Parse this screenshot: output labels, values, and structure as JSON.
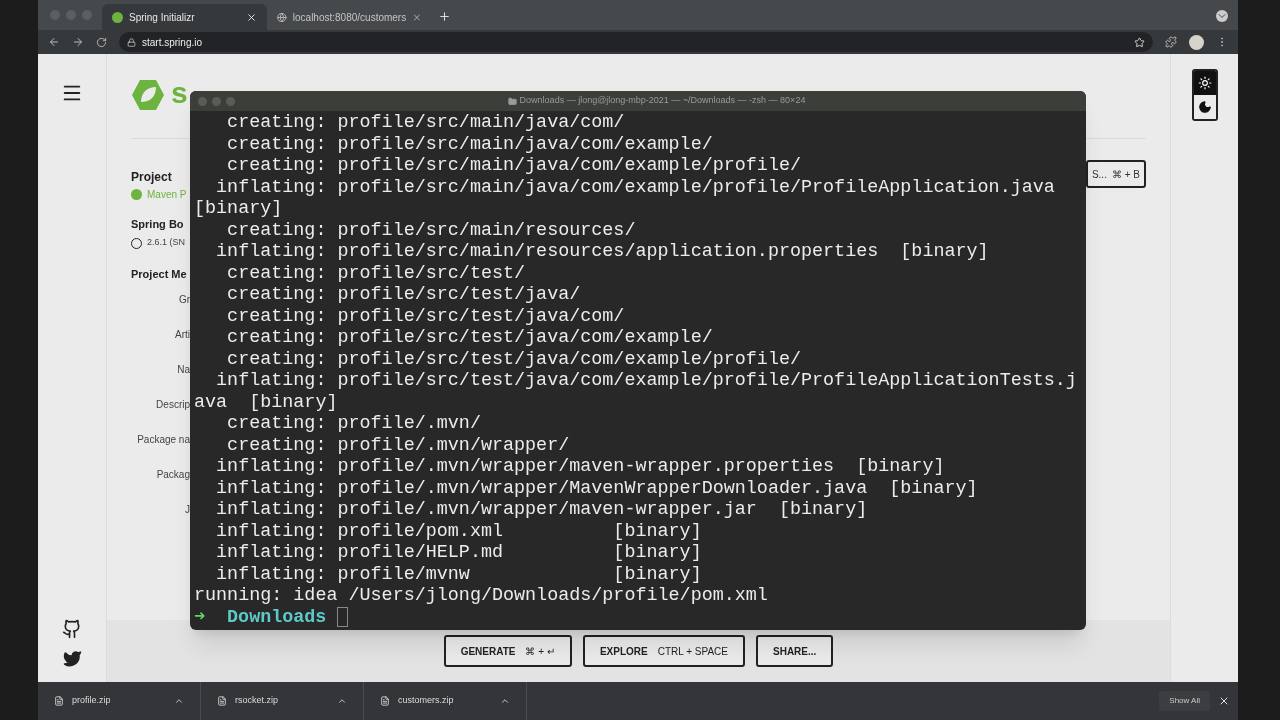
{
  "browser": {
    "tabs": [
      {
        "title": "Spring Initializr",
        "selected": true
      },
      {
        "title": "localhost:8080/customers",
        "selected": false
      }
    ],
    "address": "start.spring.io"
  },
  "page": {
    "logo_text": "s",
    "project": {
      "heading": "Project",
      "options": [
        {
          "label": "Maven P",
          "selected": true
        }
      ]
    },
    "spring_boot": {
      "heading": "Spring Bo",
      "options": [
        {
          "label": "2.6.1 (SN",
          "selected": false
        }
      ]
    },
    "metadata": {
      "heading": "Project Me",
      "labels": [
        "Gr",
        "Arti",
        "Na",
        "Descrip",
        "Package na",
        "Packag",
        "J"
      ]
    },
    "dependencies_button": {
      "label": "S...",
      "shortcut": "⌘ + B"
    },
    "theme_toggle": [
      {
        "kind": "light",
        "selected": true
      },
      {
        "kind": "dark",
        "selected": false
      }
    ],
    "actions": [
      {
        "label": "GENERATE",
        "shortcut": "⌘ + ↵"
      },
      {
        "label": "EXPLORE",
        "shortcut": "CTRL + SPACE"
      },
      {
        "label": "SHARE..."
      }
    ]
  },
  "terminal": {
    "title": "Downloads — jlong@jlong-mbp-2021 — ~/Downloads — -zsh — 80×24",
    "lines": [
      "   creating: profile/src/main/java/com/",
      "   creating: profile/src/main/java/com/example/",
      "   creating: profile/src/main/java/com/example/profile/",
      "  inflating: profile/src/main/java/com/example/profile/ProfileApplication.java",
      "[binary]",
      "   creating: profile/src/main/resources/",
      "  inflating: profile/src/main/resources/application.properties  [binary]",
      "   creating: profile/src/test/",
      "   creating: profile/src/test/java/",
      "   creating: profile/src/test/java/com/",
      "   creating: profile/src/test/java/com/example/",
      "   creating: profile/src/test/java/com/example/profile/",
      "  inflating: profile/src/test/java/com/example/profile/ProfileApplicationTests.j",
      "ava  [binary]",
      "   creating: profile/.mvn/",
      "   creating: profile/.mvn/wrapper/",
      "  inflating: profile/.mvn/wrapper/maven-wrapper.properties  [binary]",
      "  inflating: profile/.mvn/wrapper/MavenWrapperDownloader.java  [binary]",
      "  inflating: profile/.mvn/wrapper/maven-wrapper.jar  [binary]",
      "  inflating: profile/pom.xml          [binary]",
      "  inflating: profile/HELP.md          [binary]",
      "  inflating: profile/mvnw             [binary]",
      "running: idea /Users/jlong/Downloads/profile/pom.xml"
    ],
    "prompt": {
      "arrow": "➜",
      "directory": "Downloads"
    }
  },
  "downloads": {
    "items": [
      "profile.zip",
      "rsocket.zip",
      "customers.zip"
    ],
    "show_all": "Show All"
  }
}
